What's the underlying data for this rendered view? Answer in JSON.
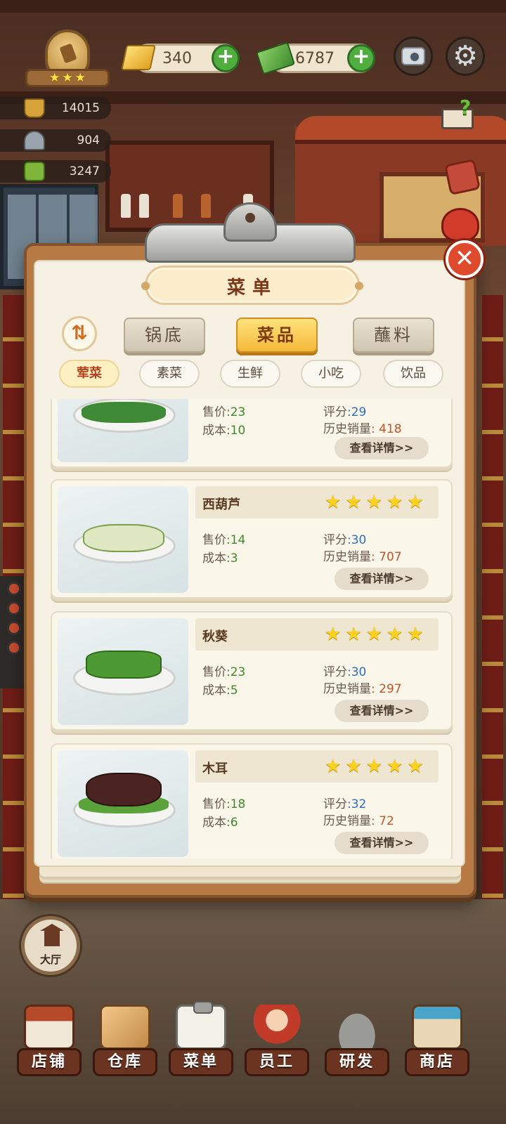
{
  "hud": {
    "gold": "340",
    "cash": "6787",
    "stats": [
      "14015",
      "904",
      "3247"
    ],
    "badge_stars": [
      "★",
      "★",
      "★"
    ],
    "plus_label": "+",
    "settings_glyph": "⚙",
    "help_glyph": "?"
  },
  "menu": {
    "title": "菜单",
    "close_glyph": "✕",
    "sort_glyph": "⇅",
    "tabs": [
      {
        "label": "锅底",
        "active": false
      },
      {
        "label": "菜品",
        "active": true
      },
      {
        "label": "蘸料",
        "active": false
      }
    ],
    "categories": [
      {
        "label": "荤菜",
        "active": true
      },
      {
        "label": "素菜",
        "active": false
      },
      {
        "label": "生鲜",
        "active": false
      },
      {
        "label": "小吃",
        "active": false
      },
      {
        "label": "饮品",
        "active": false
      }
    ],
    "labels": {
      "price": "售价",
      "cost": "成本",
      "score": "评分",
      "sales": "历史销量",
      "detail_button": "查看详情>>"
    },
    "dishes": [
      {
        "name": "",
        "price": ":23",
        "cost": ":10",
        "score": ":29",
        "sales": ": 418",
        "stars": [
          "★",
          "★",
          "★",
          "★",
          "★"
        ]
      },
      {
        "name": "西葫芦",
        "price": ":14",
        "cost": ":3",
        "score": ":30",
        "sales": ": 707",
        "stars": [
          "★",
          "★",
          "★",
          "★",
          "★"
        ]
      },
      {
        "name": "秋葵",
        "price": ":23",
        "cost": ":5",
        "score": ":30",
        "sales": ": 297",
        "stars": [
          "★",
          "★",
          "★",
          "★",
          "★"
        ]
      },
      {
        "name": "木耳",
        "price": ":18",
        "cost": ":6",
        "score": ":32",
        "sales": ": 72",
        "stars": [
          "★",
          "★",
          "★",
          "★",
          "★"
        ]
      }
    ]
  },
  "hall_button": "大厅",
  "nav": [
    {
      "label": "店铺"
    },
    {
      "label": "仓库"
    },
    {
      "label": "菜单"
    },
    {
      "label": "员工"
    },
    {
      "label": "研发"
    },
    {
      "label": "商店"
    }
  ],
  "colors": {
    "accent": "#f5b93a",
    "price_green": "#3e8a2a",
    "score_blue": "#2f6eb8",
    "sales_orange": "#c0552a",
    "close_red": "#e04a2c"
  }
}
